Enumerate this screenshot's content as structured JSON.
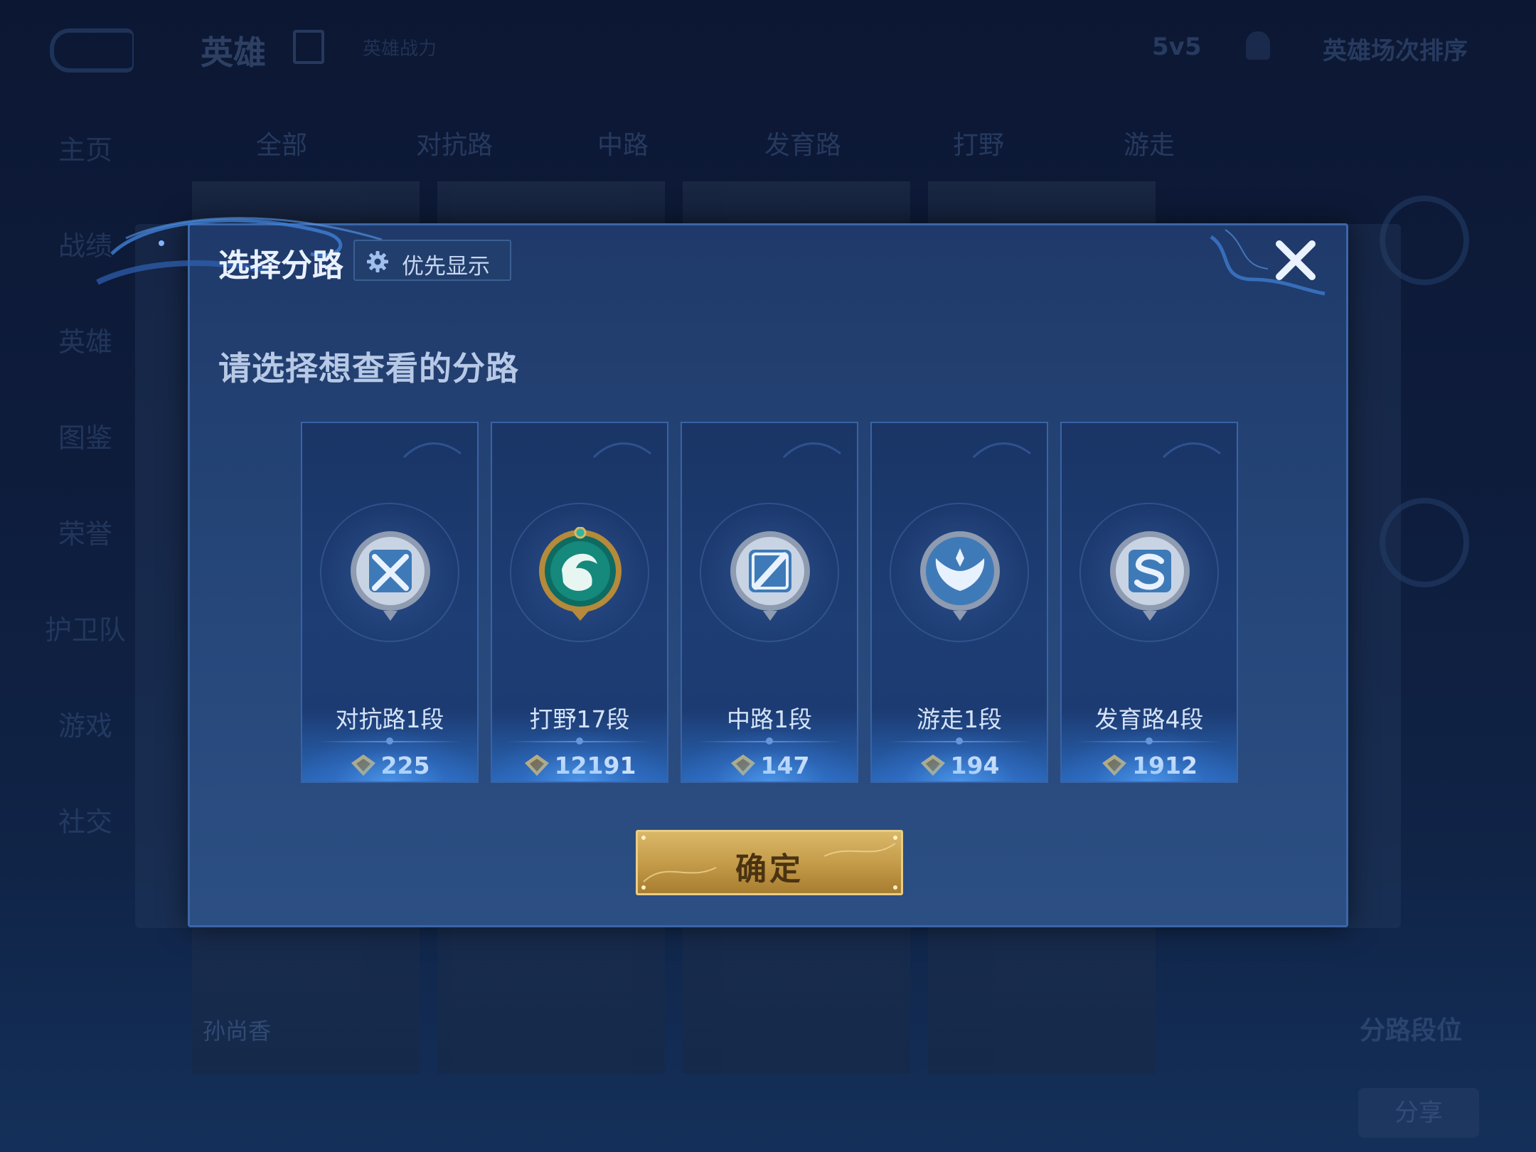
{
  "background": {
    "app_title": "英雄",
    "top_sub": "英雄战力",
    "mode": "5v5",
    "sort": "英雄场次排序",
    "lane_tabs": [
      "全部",
      "对抗路",
      "中路",
      "发育路",
      "打野",
      "游走"
    ],
    "side_nav": [
      "主页",
      "战绩",
      "英雄",
      "图鉴",
      "荣誉",
      "护卫队",
      "游戏",
      "社交"
    ],
    "hero_names": [
      "孙尚香",
      "",
      "",
      ""
    ],
    "lane_rank_label": "分路段位",
    "share": "分享"
  },
  "dialog": {
    "title": "选择分路",
    "priority_label": "优先显示",
    "prompt": "请选择想查看的分路",
    "confirm": "确定",
    "lanes": [
      {
        "name": "对抗路1段",
        "points": "225",
        "emblem": "crossed-swords-emblem"
      },
      {
        "name": "打野17段",
        "points": "12191",
        "emblem": "dragon-emblem"
      },
      {
        "name": "中路1段",
        "points": "147",
        "emblem": "mid-lane-emblem"
      },
      {
        "name": "游走1段",
        "points": "194",
        "emblem": "wings-emblem"
      },
      {
        "name": "发育路4段",
        "points": "1912",
        "emblem": "bot-lane-emblem"
      }
    ]
  },
  "colors": {
    "dialog_bg": "#26477a",
    "card_border": "#3a63a6",
    "confirm_gold": "#c59c4a",
    "text_light": "#d6e3f7"
  }
}
